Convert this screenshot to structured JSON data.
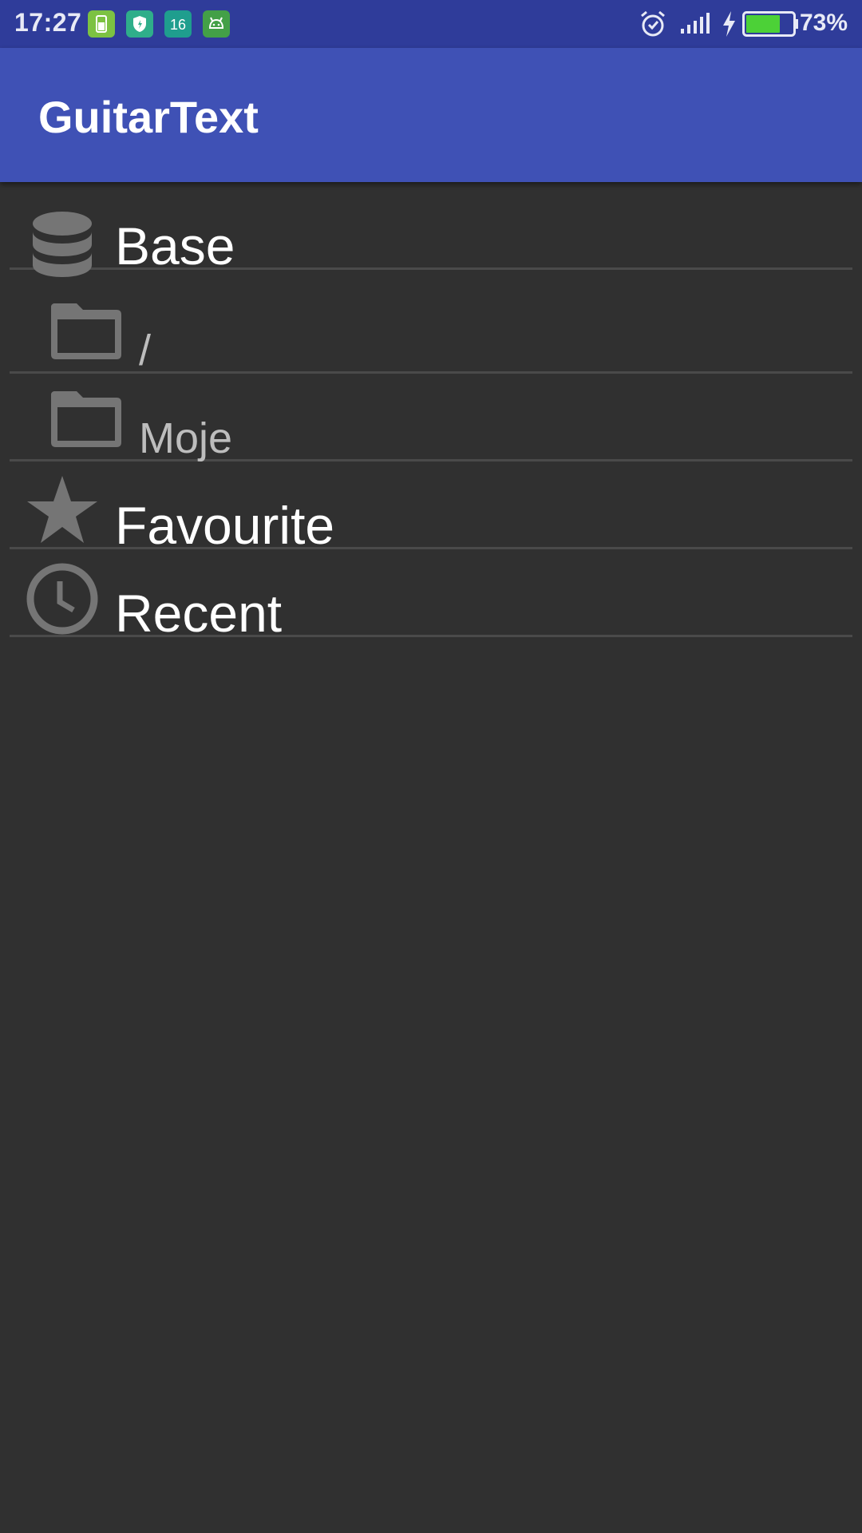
{
  "status_bar": {
    "time": "17:27",
    "notification_icons": [
      "battery-saver-icon",
      "shield-icon",
      "calendar-16-icon",
      "android-icon"
    ],
    "system_icons": [
      "alarm-icon",
      "signal-icon",
      "charging-icon",
      "battery-icon"
    ],
    "battery_percent": "73%",
    "battery_level": 0.73
  },
  "app_bar": {
    "title": "GuitarText"
  },
  "list": {
    "items": [
      {
        "label": "Base",
        "icon": "database-icon"
      },
      {
        "label": "/",
        "icon": "folder-icon"
      },
      {
        "label": "Moje",
        "icon": "folder-icon"
      },
      {
        "label": "Favourite",
        "icon": "star-icon"
      },
      {
        "label": "Recent",
        "icon": "clock-icon"
      }
    ]
  },
  "colors": {
    "status_bar": "#2f3c9a",
    "app_bar": "#3f51b5",
    "background": "#303030",
    "icon": "#757575",
    "divider": "#4a4a4a"
  }
}
